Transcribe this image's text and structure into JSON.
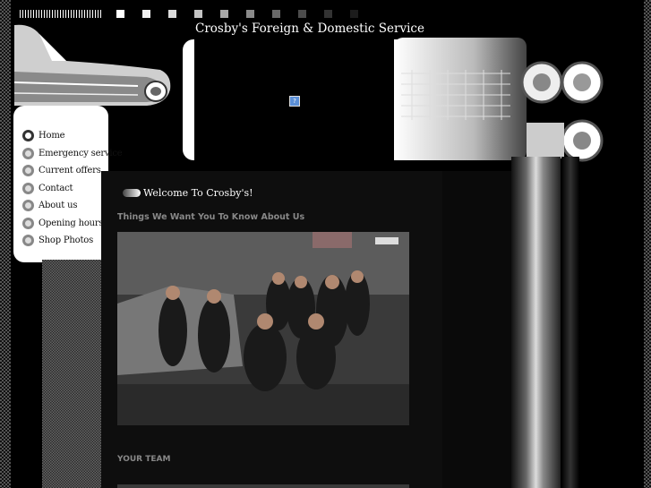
{
  "site": {
    "title": "Crosby's Foreign & Domestic Service"
  },
  "nav": {
    "items": [
      {
        "label": "Home",
        "active": true
      },
      {
        "label": "Emergency service",
        "active": false
      },
      {
        "label": "Current offers",
        "active": false
      },
      {
        "label": "Contact",
        "active": false
      },
      {
        "label": "About us",
        "active": false
      },
      {
        "label": "Opening hours",
        "active": false
      },
      {
        "label": "Shop Photos",
        "active": false
      }
    ]
  },
  "main": {
    "welcome_heading": "Welcome To Crosby's!",
    "subheading": "Things We Want You To Know About Us",
    "section_team": "YOUR TEAM"
  },
  "banner": {
    "broken_image_glyph": "?"
  },
  "colors": {
    "background": "#000000",
    "nav_bg": "#ffffff",
    "subhead": "#888888"
  }
}
